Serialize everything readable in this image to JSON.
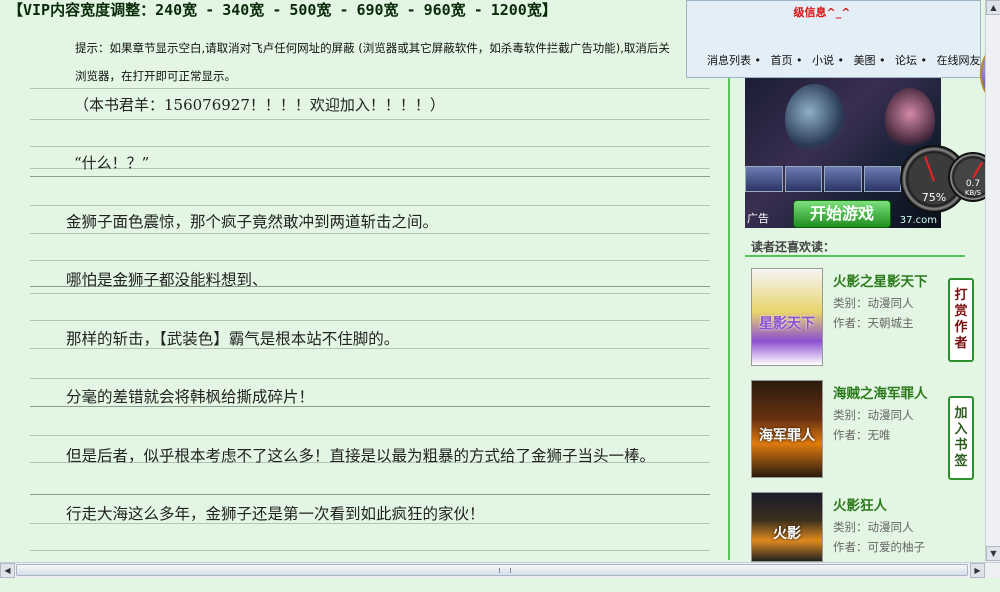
{
  "width_bar": {
    "label": "【VIP内容宽度调整：",
    "options": [
      "240宽",
      "340宽",
      "500宽",
      "690宽",
      "960宽",
      "1200宽"
    ],
    "dash": "-",
    "close": "】"
  },
  "tip": {
    "line1": "提示：如果章节显示空白,请取消对飞卢任何网址的屏蔽 (浏览器或其它屏蔽软件，如杀毒软件拦截广告功能),取消后关",
    "line2": "浏览器，在打开即可正常显示。"
  },
  "paragraphs": [
    "（本书君羊：156076927！！！！欢迎加入！！！！）",
    "“什么！？”",
    "金狮子面色震惊，那个疯子竟然敢冲到两道斩击之间。",
    "哪怕是金狮子都没能料想到、",
    "那样的斩击，【武装色】霸气是根本站不住脚的。",
    "分毫的差错就会将韩枫给撕成碎片！",
    "但是后者，似乎根本考虑不了这么多！直接是以最为粗暴的方式给了金狮子当头一棒。",
    "行走大海这么多年，金狮子还是第一次看到如此疯狂的家伙！"
  ],
  "popup": {
    "title": "级信息^_^",
    "links": [
      "消息列表 •",
      "首页 •",
      "小说 •",
      "美图 •",
      "论坛 •",
      "在线网友"
    ]
  },
  "ad": {
    "start_label": "开始游戏",
    "ad_label": "广告",
    "brand": "37.com"
  },
  "gauges": {
    "main_value": "75%",
    "speed_value": "0.7",
    "speed_unit": "KB/S"
  },
  "recommend": {
    "title": "读者还喜欢读：",
    "books": [
      {
        "title": "火影之星影天下",
        "category": "类别：动漫同人",
        "author": "作者：天朝城主",
        "cover_text": "星影天下"
      },
      {
        "title": "海贼之海军罪人",
        "category": "类别：动漫同人",
        "author": "作者：无唯",
        "cover_text": "海军罪人"
      },
      {
        "title": "火影狂人",
        "category": "类别：动漫同人",
        "author": "作者：可爱的柚子",
        "cover_text": "火影"
      }
    ]
  },
  "side_buttons": {
    "reward": "打赏作者",
    "bookmark": "加入书签"
  },
  "scroll": {
    "up": "▲",
    "down": "▼",
    "left": "◀",
    "right": "▶"
  }
}
